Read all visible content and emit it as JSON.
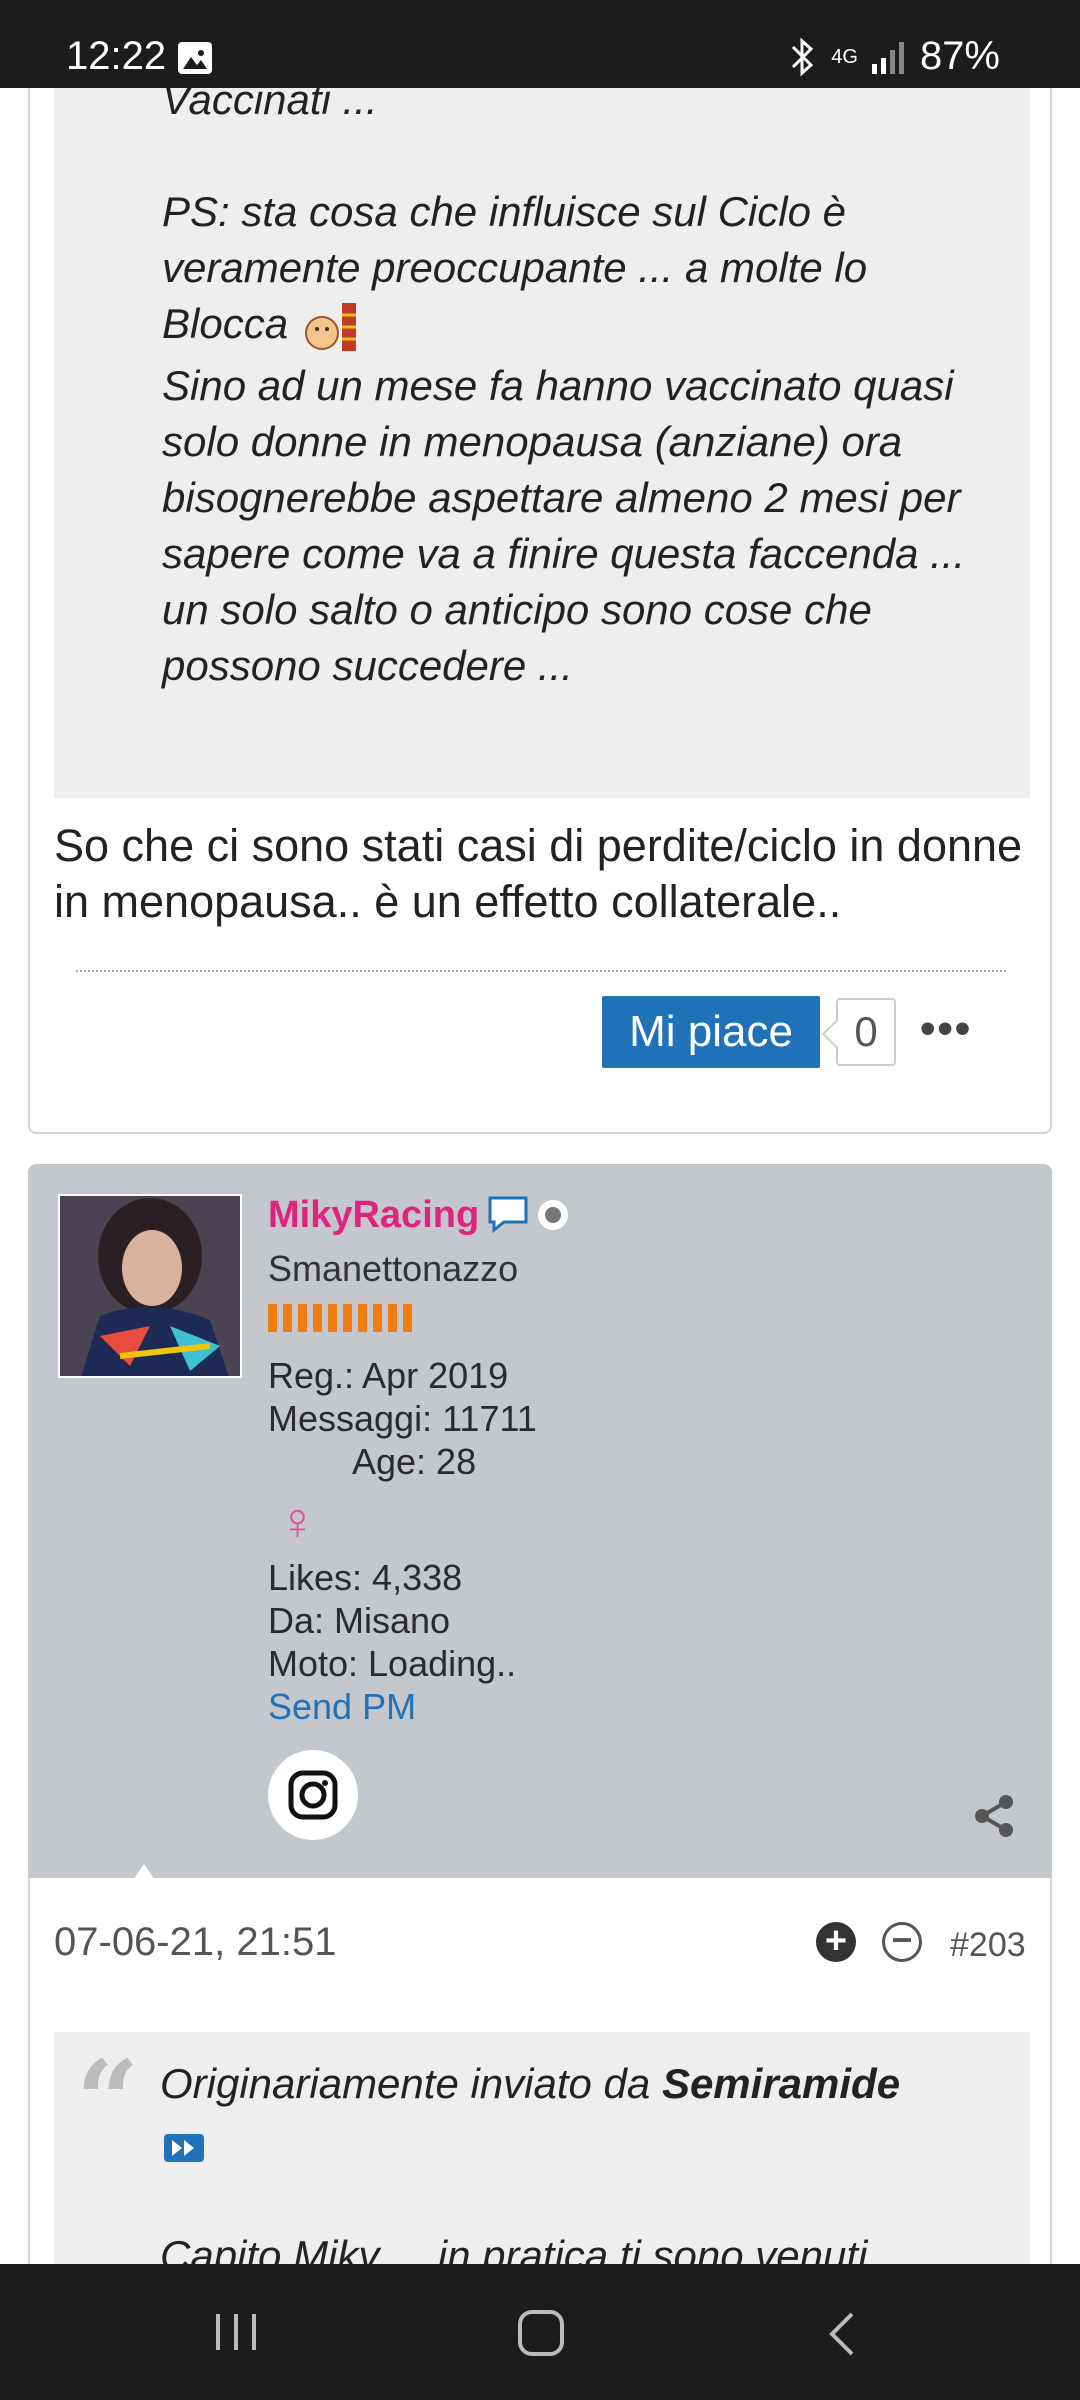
{
  "status_bar": {
    "time": "12:22",
    "network": "4G",
    "battery": "87%",
    "icons": [
      "image-icon",
      "bluetooth-icon",
      "signal-icon"
    ]
  },
  "post1": {
    "quote_lines_top": "Vaccinati ...\n\nPS: sta cosa che influisce sul Ciclo è\nveramente preoccupante ... a molte lo\nBlocca ",
    "quote_lines_rest": "Sino ad un mese fa hanno vaccinato quasi solo donne in menopausa (anziane) ora bisognerebbe aspettare almeno 2 mesi per sapere come va a finire questa faccenda ... un solo salto o anticipo sono cose che possono succedere ...",
    "reply_text": "So che ci sono stati casi di perdite/ciclo in donne in menopausa.. è un effetto collaterale..",
    "like_label": "Mi piace",
    "like_count": "0",
    "more_label": "•••"
  },
  "user": {
    "username": "MikyRacing",
    "title": "Smanettonazzo",
    "reputation_bars": 10,
    "registered": "Reg.: Apr 2019",
    "messages": "Messaggi: 11711",
    "age": "Age: 28",
    "gender_symbol": "♀",
    "likes": "Likes: 4,338",
    "location": "Da: Misano",
    "moto": "Moto: Loading..",
    "send_pm": "Send PM"
  },
  "post2": {
    "date": "07-06-21, 21:51",
    "post_number": "#203",
    "quote_prefix": "Originariamente inviato da ",
    "quote_author": "Semiramide",
    "quote_start": "Capito Miky ... in pratica ti sono venuti"
  },
  "colors": {
    "accent_blue": "#1f72b8",
    "username_pink": "#e0237f",
    "user_bg": "#c4c7cb",
    "rep_orange": "#f07d12"
  }
}
